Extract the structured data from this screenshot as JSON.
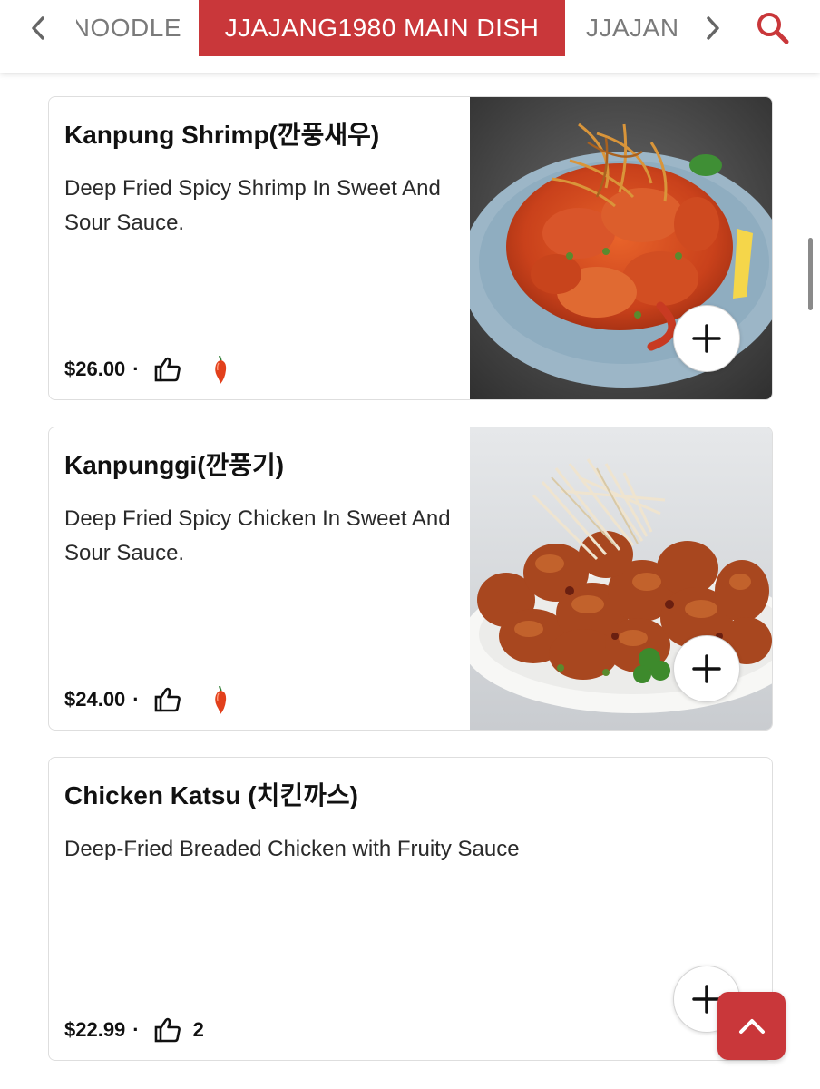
{
  "category_nav": {
    "prev_tab_label": "NOODLE",
    "active_tab_label": "JJAJANG1980 MAIN DISH",
    "next_tab_label": "JJAJANG",
    "accent_color": "#c9373a"
  },
  "menu_items": [
    {
      "name": "Kanpung Shrimp(깐풍새우)",
      "description": "Deep Fried Spicy Shrimp In Sweet And Sour Sauce.",
      "price": "$26.00",
      "separator": "·",
      "likes": "",
      "spicy": true,
      "photo": "fried-shrimp-on-blue-plate"
    },
    {
      "name": "Kanpunggi(깐풍기)",
      "description": "Deep Fried Spicy Chicken In Sweet And Sour Sauce.",
      "price": "$24.00",
      "separator": "·",
      "likes": "",
      "spicy": true,
      "photo": "fried-chicken-on-white-plate"
    },
    {
      "name": "Chicken Katsu (치킨까스)",
      "description": "Deep-Fried Breaded Chicken with Fruity Sauce",
      "price": "$22.99",
      "separator": "·",
      "likes": "2",
      "spicy": false,
      "photo": ""
    }
  ],
  "icons": {
    "back": "chevron-left-icon",
    "forward": "chevron-right-icon",
    "search": "search-icon",
    "like": "thumbs-up-icon",
    "spicy": "chili-pepper-icon",
    "add": "plus-icon",
    "scroll_top": "chevron-up-icon"
  }
}
